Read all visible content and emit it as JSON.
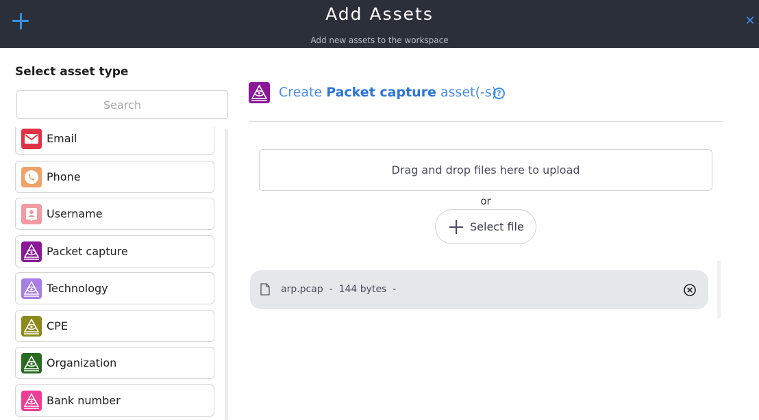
{
  "header": {
    "title": "Add Assets",
    "subtitle": "Add new assets to the workspace",
    "add_icon": "plus-icon",
    "close_icon": "close-icon",
    "background": "#2b2f3a",
    "accent": "#3b8fe6"
  },
  "sidebar": {
    "title": "Select asset type",
    "search_placeholder": "Search",
    "items": [
      {
        "label": "Email",
        "icon": "email-icon",
        "color": "#e03246"
      },
      {
        "label": "Phone",
        "icon": "phone-icon",
        "color": "#eea36a"
      },
      {
        "label": "Username",
        "icon": "user-badge-icon",
        "color": "#f29ba2"
      },
      {
        "label": "Packet capture",
        "icon": "eye-pyramid-icon",
        "color": "#8a1897"
      },
      {
        "label": "Technology",
        "icon": "eye-pyramid-icon",
        "color": "#a97ee2"
      },
      {
        "label": "CPE",
        "icon": "eye-pyramid-icon",
        "color": "#8c8a1b"
      },
      {
        "label": "Organization",
        "icon": "eye-pyramid-icon",
        "color": "#2a6a22"
      },
      {
        "label": "Bank number",
        "icon": "eye-pyramid-icon",
        "color": "#ee3d93"
      }
    ]
  },
  "main": {
    "create_prefix": "Create",
    "asset_type": "Packet capture",
    "create_suffix": "asset(-s)",
    "help_icon": "help-icon",
    "help_glyph": "?",
    "dropzone_text": "Drag and drop files here to upload",
    "or_text": "or",
    "select_file_label": "Select file",
    "files": [
      {
        "name": "arp.pcap",
        "sep1": "-",
        "size": "144 bytes",
        "sep2": "-"
      }
    ]
  }
}
